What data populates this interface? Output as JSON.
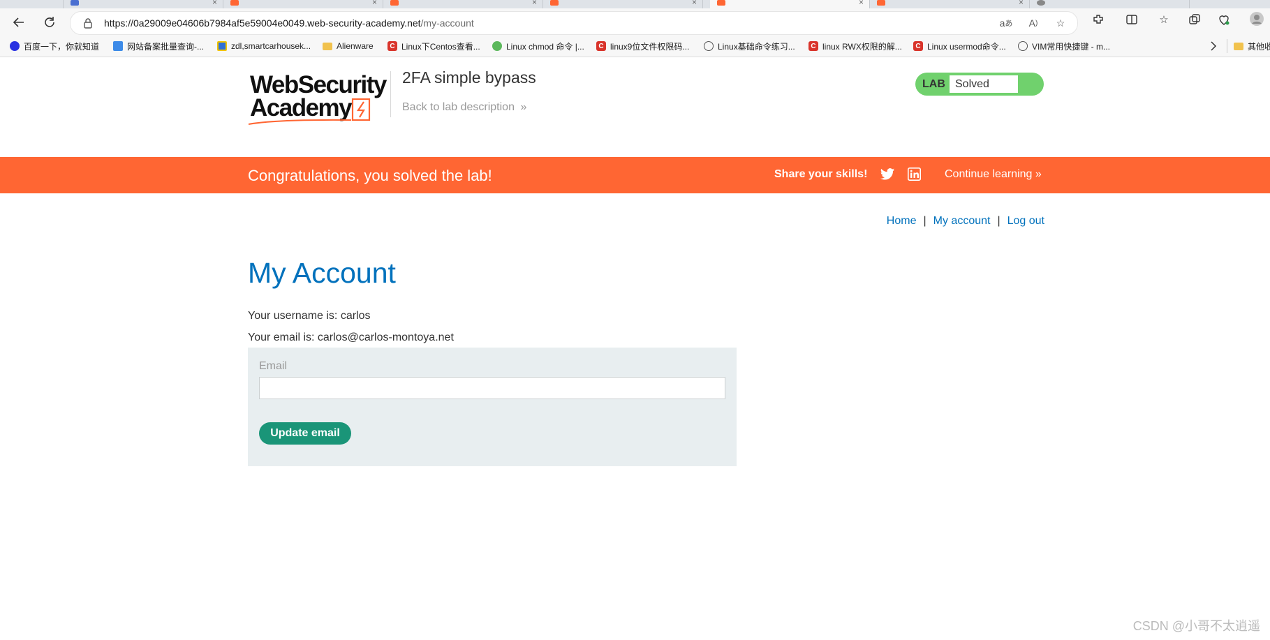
{
  "browser": {
    "tabs": [
      {
        "favicon_color": "#4a6fd1"
      },
      {
        "favicon_color": "#ff6633"
      },
      {
        "favicon_color": "#ff6633"
      },
      {
        "favicon_color": "#ff6633"
      },
      {
        "favicon_color": "#ff6633"
      },
      {
        "favicon_color": "#ff6633"
      },
      {
        "favicon_color": "#888888"
      }
    ],
    "url_host": "https://0a29009e04606b7984af5e59004e0049.web-security-academy.net",
    "url_path": "/my-account",
    "bookmarks": [
      {
        "label": "百度一下，你就知道",
        "icon": "baidu-icon"
      },
      {
        "label": "网站备案批量查询-...",
        "icon": "chart-icon"
      },
      {
        "label": "zdl,smartcarhousek...",
        "icon": "app-icon"
      },
      {
        "label": "Alienware",
        "icon": "folder-icon"
      },
      {
        "label": "Linux下Centos查看...",
        "icon": "csdn-icon"
      },
      {
        "label": "Linux chmod 命令 |...",
        "icon": "runoob-icon"
      },
      {
        "label": "linux9位文件权限码...",
        "icon": "csdn-icon"
      },
      {
        "label": "Linux基础命令练习...",
        "icon": "sword-icon"
      },
      {
        "label": "linux RWX权限的解...",
        "icon": "csdn-icon"
      },
      {
        "label": "Linux usermod命令...",
        "icon": "csdn-icon"
      },
      {
        "label": "VIM常用快捷键 - m...",
        "icon": "sword-icon"
      }
    ],
    "bookmarks_other": "其他收"
  },
  "header": {
    "logo_line1": "WebSecurity",
    "logo_line2": "Academy",
    "lab_title": "2FA simple bypass",
    "back_link": "Back to lab description",
    "lab_badge_label": "LAB",
    "lab_status": "Solved",
    "lab_badge_color": "#70d16d"
  },
  "banner": {
    "message": "Congratulations, you solved the lab!",
    "share": "Share your skills!",
    "continue": "Continue learning",
    "color": "#ff6633"
  },
  "nav": {
    "home": "Home",
    "separator": "|",
    "account": "My account",
    "logout": "Log out"
  },
  "main": {
    "title": "My Account",
    "username_line": "Your username is: carlos",
    "email_line": "Your email is: carlos@carlos-montoya.net",
    "email_label": "Email",
    "email_value": "",
    "update_button": "Update email",
    "button_color": "#1a9578"
  },
  "watermark": "CSDN @小哥不太逍遥"
}
